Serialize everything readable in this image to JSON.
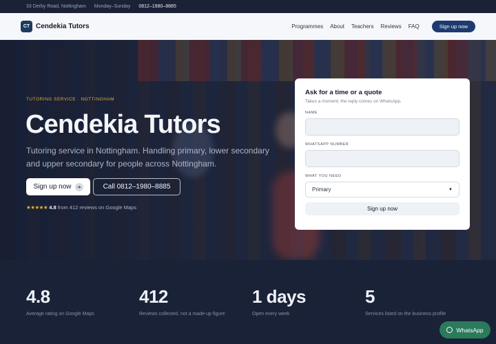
{
  "topbar": {
    "address": "33 Derby Road, Nottingham",
    "hours": "Monday–Sunday",
    "phone": "0812–1980–8885"
  },
  "nav": {
    "logo_initials": "CT",
    "brand": "Cendekia Tutors",
    "links": [
      "Programmes",
      "About",
      "Teachers",
      "Reviews",
      "FAQ"
    ],
    "cta": "Sign up now"
  },
  "hero": {
    "eyebrow": "TUTORING SERVICE · NOTTINGHAM",
    "title": "Cendekia Tutors",
    "subtitle": "Tutoring service in Nottingham. Handling primary, lower secondary and upper secondary for people across Nottingham.",
    "primary_button": "Sign up now",
    "primary_button_icon": "arrow-right-icon",
    "call_button": "Call 0812–1980–8885",
    "rating_stars": "★★★★★",
    "rating_score": "4.8",
    "rating_text": "from 412 reviews on Google Maps"
  },
  "form": {
    "title": "Ask for a time or a quote",
    "subtitle": "Takes a moment; the reply comes on WhatsApp.",
    "name_label": "NAME",
    "name_value": "",
    "whatsapp_label": "WHATSAPP NUMBER",
    "whatsapp_value": "",
    "need_label": "WHAT YOU NEED",
    "need_value": "Primary",
    "submit": "Sign up now"
  },
  "stats": [
    {
      "value": "4.8",
      "label": "Average rating on Google Maps"
    },
    {
      "value": "412",
      "label": "Reviews collected, not a made-up figure"
    },
    {
      "value": "1 days",
      "label": "Open every week"
    },
    {
      "value": "5",
      "label": "Services listed on the business profile"
    }
  ],
  "whatsapp_button": "WhatsApp",
  "colors": {
    "accent": "#e6a93b",
    "brand": "#1e3a6e",
    "whatsapp": "#2a7a5c"
  }
}
